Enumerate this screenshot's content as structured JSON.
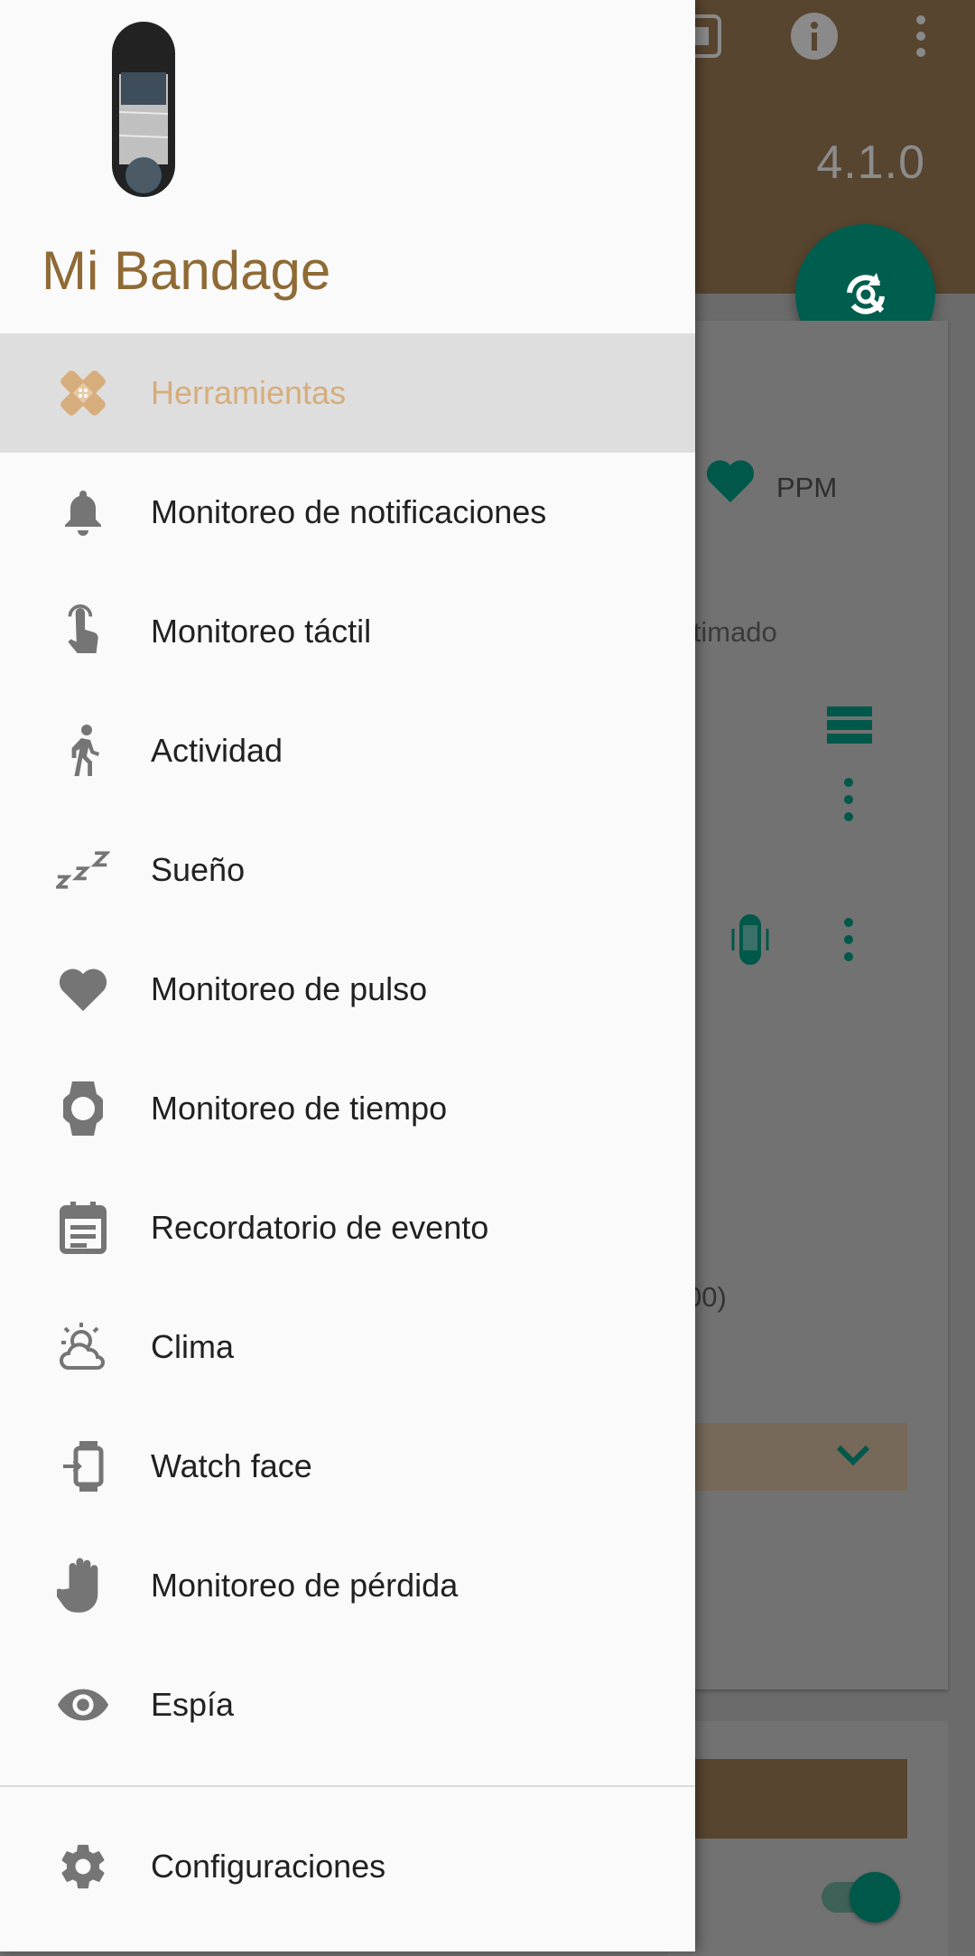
{
  "background": {
    "version": "4.1.0",
    "heart_rate_unit": "PPM",
    "estimated_fragment": "estimado",
    "paren_fragment": "00)"
  },
  "drawer": {
    "app_title": "Mi Bandage",
    "items": [
      {
        "label": "Herramientas",
        "icon": "bandage-icon",
        "selected": true
      },
      {
        "label": "Monitoreo de notificaciones",
        "icon": "bell-icon"
      },
      {
        "label": "Monitoreo táctil",
        "icon": "touch-icon"
      },
      {
        "label": "Actividad",
        "icon": "walk-icon"
      },
      {
        "label": "Sueño",
        "icon": "sleep-icon"
      },
      {
        "label": "Monitoreo de pulso",
        "icon": "heart-icon"
      },
      {
        "label": "Monitoreo de tiempo",
        "icon": "watch-icon"
      },
      {
        "label": "Recordatorio de evento",
        "icon": "event-icon"
      },
      {
        "label": "Clima",
        "icon": "weather-icon"
      },
      {
        "label": "Watch face",
        "icon": "watch-face-icon"
      },
      {
        "label": "Monitoreo de pérdida",
        "icon": "hand-icon"
      },
      {
        "label": "Espía",
        "icon": "eye-icon"
      }
    ],
    "settings_label": "Configuraciones"
  },
  "colors": {
    "accent": "#8f6a35",
    "selected_text": "#d6ad7c",
    "teal": "#00695c"
  }
}
